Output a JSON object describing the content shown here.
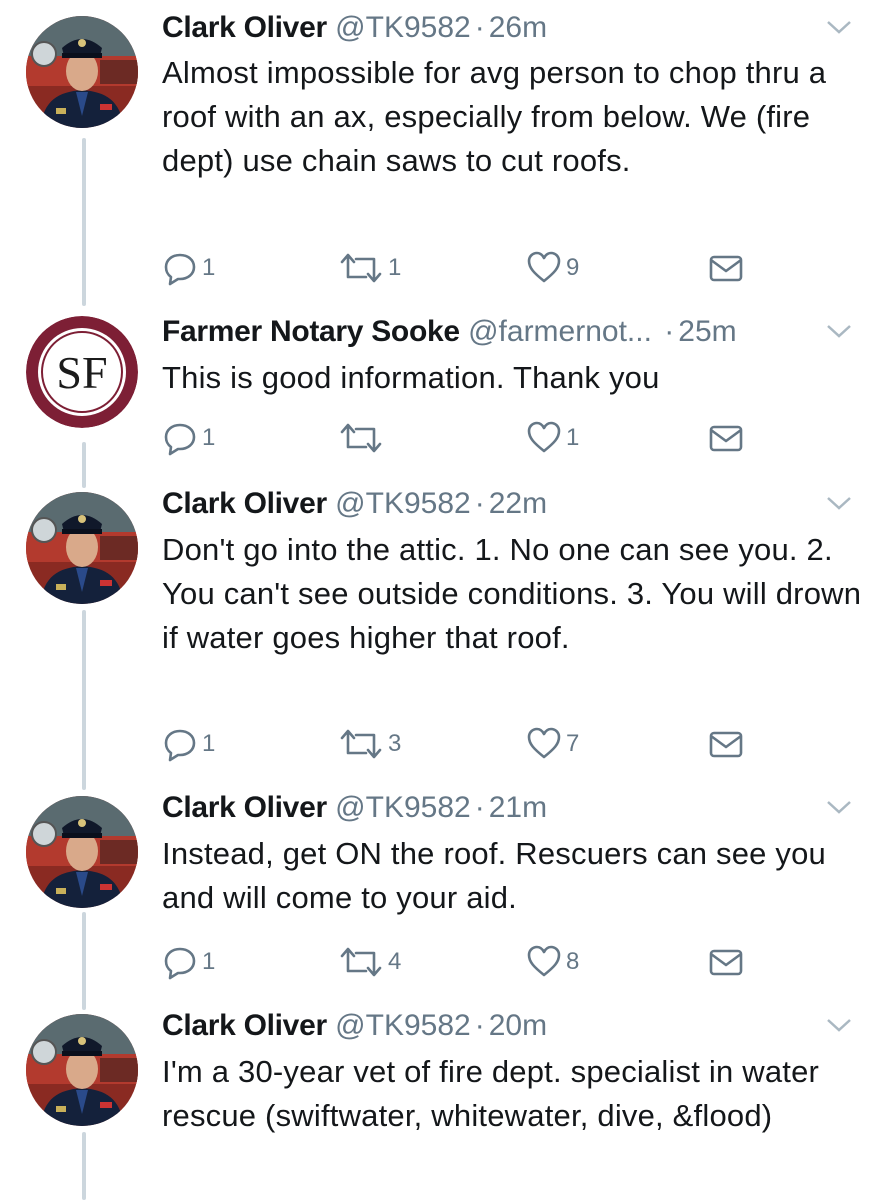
{
  "tweets": [
    {
      "avatar": "firefighter-avatar",
      "name": "Clark Oliver",
      "handle": "@TK9582",
      "separator": "·",
      "time": "26m",
      "text": "Almost impossible for avg person to chop thru a roof with an ax, especially from below. We (fire dept) use chain saws to cut roofs.",
      "replies": "1",
      "retweets": "1",
      "likes": "9"
    },
    {
      "avatar": "sf-logo-avatar",
      "avatar_text": "SF",
      "name": "Farmer Notary Sooke",
      "handle": "@farmernot...",
      "separator": "·",
      "time": "25m",
      "text": "This is good information. Thank you",
      "replies": "1",
      "retweets": "",
      "likes": "1"
    },
    {
      "avatar": "firefighter-avatar",
      "name": "Clark Oliver",
      "handle": "@TK9582",
      "separator": "·",
      "time": "22m",
      "text": "Don't go into the attic. 1. No one can see you. 2. You can't see outside conditions. 3. You will drown if water goes higher that roof.",
      "replies": "1",
      "retweets": "3",
      "likes": "7"
    },
    {
      "avatar": "firefighter-avatar",
      "name": "Clark Oliver",
      "handle": "@TK9582",
      "separator": "·",
      "time": "21m",
      "text": "Instead, get ON the roof. Rescuers can see you and will come to your aid.",
      "replies": "1",
      "retweets": "4",
      "likes": "8"
    },
    {
      "avatar": "firefighter-avatar",
      "name": "Clark Oliver",
      "handle": "@TK9582",
      "separator": "·",
      "time": "20m",
      "text": "I'm a 30-year vet of fire dept. specialist in water rescue (swiftwater, whitewater, dive, &flood)"
    }
  ],
  "colors": {
    "text": "#14171a",
    "secondary": "#657786",
    "thread_line": "#ccd6dd",
    "logo_maroon": "#7d1f35"
  }
}
